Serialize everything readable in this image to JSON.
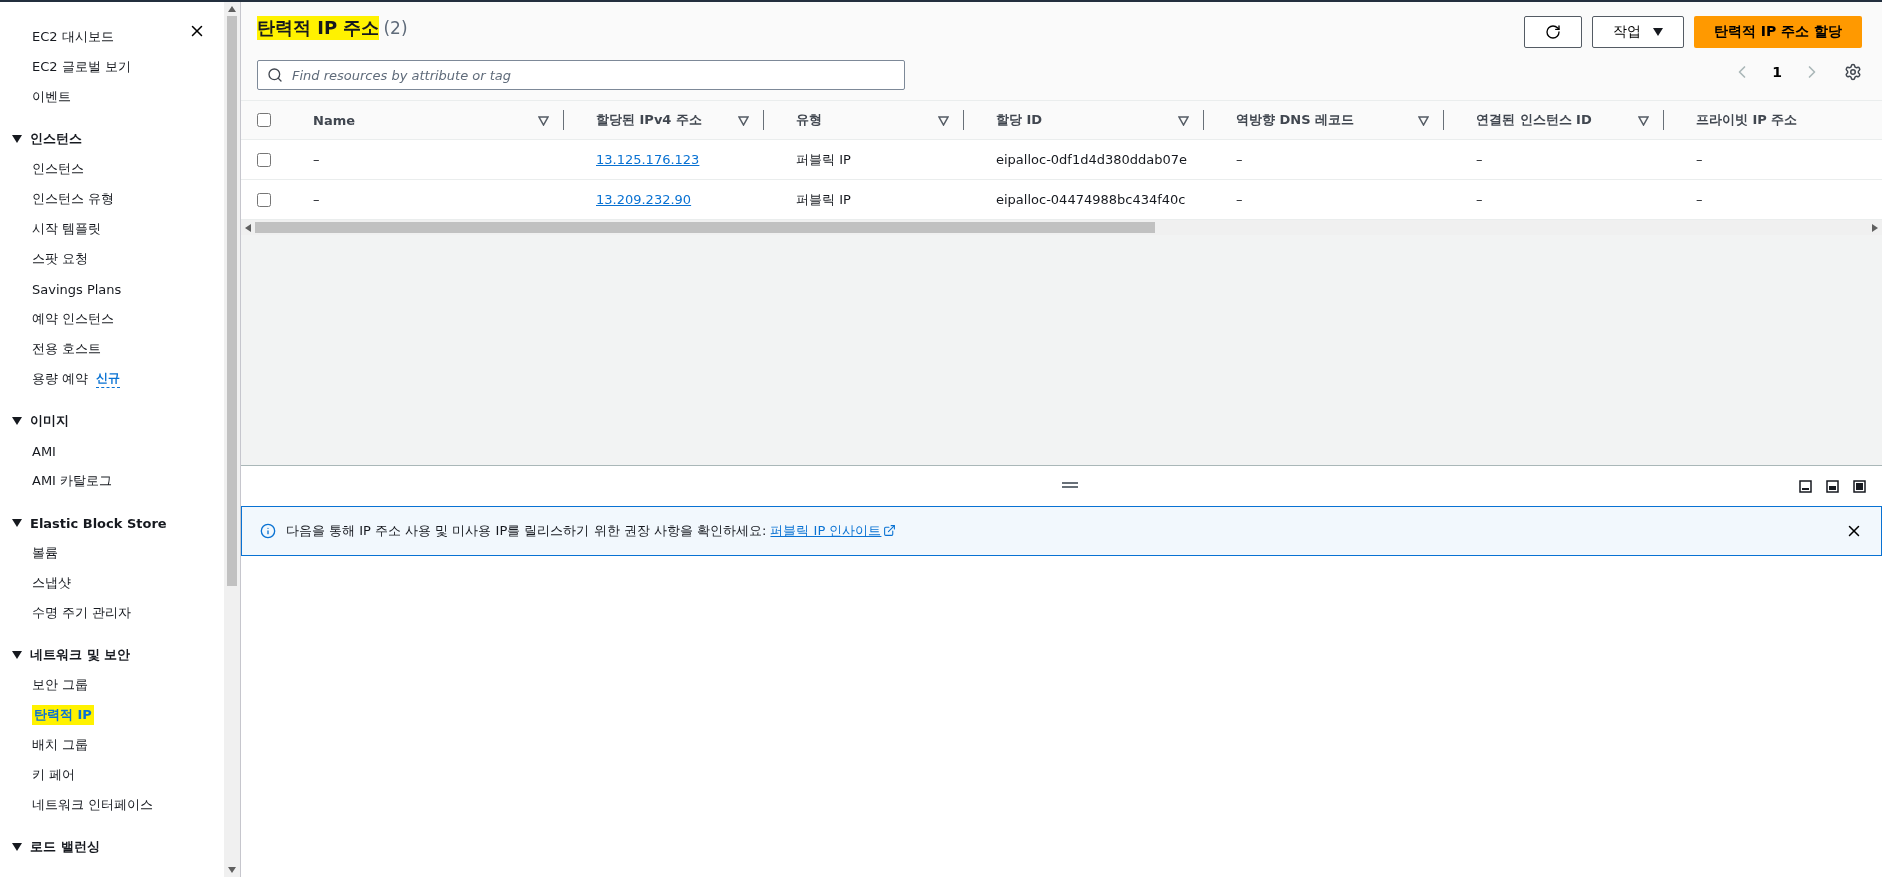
{
  "sidebar": {
    "groups": [
      {
        "items": [
          {
            "label": "EC2 대시보드",
            "selected": false,
            "highlighted": false
          },
          {
            "label": "EC2 글로벌 보기",
            "selected": false,
            "highlighted": false
          },
          {
            "label": "이벤트",
            "selected": false,
            "highlighted": false
          }
        ]
      },
      {
        "title": "인스턴스",
        "expanded": true,
        "items": [
          {
            "label": "인스턴스",
            "selected": false,
            "highlighted": false
          },
          {
            "label": "인스턴스 유형",
            "selected": false,
            "highlighted": false
          },
          {
            "label": "시작 템플릿",
            "selected": false,
            "highlighted": false
          },
          {
            "label": "스팟 요청",
            "selected": false,
            "highlighted": false
          },
          {
            "label": "Savings Plans",
            "selected": false,
            "highlighted": false
          },
          {
            "label": "예약 인스턴스",
            "selected": false,
            "highlighted": false
          },
          {
            "label": "전용 호스트",
            "selected": false,
            "highlighted": false
          },
          {
            "label": "용량 예약",
            "badge": "신규",
            "selected": false,
            "highlighted": false
          }
        ]
      },
      {
        "title": "이미지",
        "expanded": true,
        "items": [
          {
            "label": "AMI",
            "selected": false,
            "highlighted": false
          },
          {
            "label": "AMI 카탈로그",
            "selected": false,
            "highlighted": false
          }
        ]
      },
      {
        "title": "Elastic Block Store",
        "expanded": true,
        "items": [
          {
            "label": "볼륨",
            "selected": false,
            "highlighted": false
          },
          {
            "label": "스냅샷",
            "selected": false,
            "highlighted": false
          },
          {
            "label": "수명 주기 관리자",
            "selected": false,
            "highlighted": false
          }
        ]
      },
      {
        "title": "네트워크 및 보안",
        "expanded": true,
        "items": [
          {
            "label": "보안 그룹",
            "selected": false,
            "highlighted": false
          },
          {
            "label": "탄력적 IP",
            "selected": true,
            "highlighted": true
          },
          {
            "label": "배치 그룹",
            "selected": false,
            "highlighted": false
          },
          {
            "label": "키 페어",
            "selected": false,
            "highlighted": false
          },
          {
            "label": "네트워크 인터페이스",
            "selected": false,
            "highlighted": false
          }
        ]
      },
      {
        "title": "로드 밸런싱",
        "expanded": true
      }
    ]
  },
  "header": {
    "title": "탄력적 IP 주소",
    "title_highlighted": true,
    "count": "(2)",
    "actions_label": "작업",
    "primary_label": "탄력적 IP 주소 할당"
  },
  "search": {
    "placeholder": "Find resources by attribute or tag"
  },
  "pagination": {
    "page": "1"
  },
  "table": {
    "select_all_checked": false,
    "columns": [
      {
        "label": "Name",
        "kind": "text"
      },
      {
        "label": "할당된 IPv4 주소",
        "kind": "link"
      },
      {
        "label": "유형",
        "kind": "text"
      },
      {
        "label": "할당 ID",
        "kind": "text"
      },
      {
        "label": "역방향 DNS 레코드",
        "kind": "text"
      },
      {
        "label": "연결된 인스턴스 ID",
        "kind": "text"
      },
      {
        "label": "프라이빗 IP 주소",
        "kind": "text"
      }
    ],
    "rows": [
      {
        "checked": false,
        "cells": [
          "–",
          "13.125.176.123",
          "퍼블릭 IP",
          "eipalloc-0df1d4d380ddab07e",
          "–",
          "–",
          "–"
        ]
      },
      {
        "checked": false,
        "cells": [
          "–",
          "13.209.232.90",
          "퍼블릭 IP",
          "eipalloc-04474988bc434f40c",
          "–",
          "–",
          "–"
        ]
      }
    ]
  },
  "info": {
    "text": "다음을 통해 IP 주소 사용 및 미사용 IP를 릴리스하기 위한 권장 사항을 확인하세요:",
    "link": "퍼블릭 IP 인사이트"
  }
}
